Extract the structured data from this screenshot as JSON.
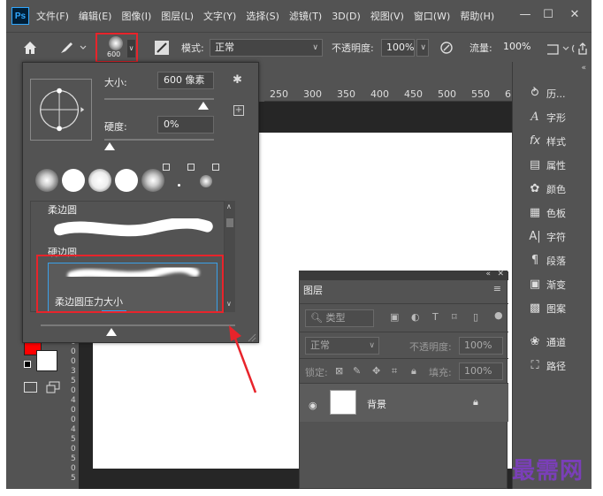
{
  "app": {
    "logo": "Ps"
  },
  "menu": [
    "文件(F)",
    "编辑(E)",
    "图像(I)",
    "图层(L)",
    "文字(Y)",
    "选择(S)",
    "滤镜(T)",
    "3D(D)",
    "视图(V)",
    "窗口(W)",
    "帮助(H)"
  ],
  "window": {
    "minimize": "—",
    "maximize": "☐",
    "close": "✕"
  },
  "options": {
    "brush_size": "600",
    "mode_label": "模式:",
    "mode_value": "正常",
    "opacity_label": "不透明度:",
    "opacity_value": "100%",
    "flow_label": "流量:",
    "flow_value": "100%"
  },
  "ruler": [
    "250",
    "300",
    "350",
    "400",
    "450",
    "500",
    "550",
    "6"
  ],
  "vruler": [
    "0",
    "0",
    "0",
    "3",
    "5",
    "0",
    "4",
    "0",
    "0",
    "4",
    "5",
    "0",
    "5",
    "0",
    "5"
  ],
  "popup": {
    "size_label": "大小:",
    "size_value": "600 像素",
    "hardness_label": "硬度:",
    "hardness_value": "0%",
    "presets": [
      {
        "name": "柔边圆"
      },
      {
        "name": "硬边圆"
      },
      {
        "name": "柔边圆压力大小"
      }
    ]
  },
  "dock": [
    {
      "label": "历...",
      "icon": "history-icon"
    },
    {
      "label": "字形",
      "icon": "glyphs-icon"
    },
    {
      "label": "样式",
      "icon": "styles-icon"
    },
    {
      "label": "属性",
      "icon": "properties-icon"
    },
    {
      "label": "颜色",
      "icon": "color-icon"
    },
    {
      "label": "色板",
      "icon": "swatches-icon"
    },
    {
      "label": "字符",
      "icon": "character-icon"
    },
    {
      "label": "段落",
      "icon": "paragraph-icon"
    },
    {
      "label": "渐变",
      "icon": "gradient-icon"
    },
    {
      "label": "图案",
      "icon": "patterns-icon"
    },
    {
      "label": "通道",
      "icon": "channels-icon"
    },
    {
      "label": "路径",
      "icon": "paths-icon"
    }
  ],
  "layers": {
    "tab": "图层",
    "filter_kind": "类型",
    "blend_mode": "正常",
    "opacity_label": "不透明度:",
    "opacity_value": "100%",
    "lock_label": "锁定:",
    "fill_label": "填充:",
    "fill_value": "100%",
    "layer_name": "背景"
  },
  "watermark": "最需网",
  "colors": {
    "foreground": "#ff0000",
    "background": "#ffffff",
    "annotation": "#e8242b",
    "selection": "#3aa0e8"
  }
}
